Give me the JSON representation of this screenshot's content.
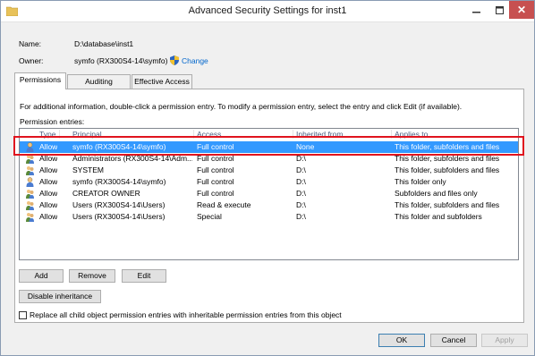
{
  "window": {
    "title": "Advanced Security Settings for inst1",
    "close_glyph": "✕"
  },
  "fields": {
    "name_label": "Name:",
    "name_value": "D:\\database\\inst1",
    "owner_label": "Owner:",
    "owner_value": "symfo (RX300S4-14\\symfo)",
    "change_link": "Change"
  },
  "tabs": [
    {
      "label": "Permissions",
      "active": true
    },
    {
      "label": "Auditing",
      "active": false
    },
    {
      "label": "Effective Access",
      "active": false
    }
  ],
  "permissions": {
    "info_text": "For additional information, double-click a permission entry. To modify a permission entry, select the entry and click Edit (if available).",
    "entries_label": "Permission entries:",
    "columns": [
      "Type",
      "Principal",
      "Access",
      "Inherited from",
      "Applies to"
    ],
    "rows": [
      {
        "type": "Allow",
        "principal": "symfo (RX300S4-14\\symfo)",
        "access": "Full control",
        "inherited": "None",
        "applies": "This folder, subfolders and files",
        "selected": true,
        "icon": "single-user-icon"
      },
      {
        "type": "Allow",
        "principal": "Administrators (RX300S4-14\\Adm...",
        "access": "Full control",
        "inherited": "D:\\",
        "applies": "This folder, subfolders and files",
        "selected": false,
        "icon": "group-icon"
      },
      {
        "type": "Allow",
        "principal": "SYSTEM",
        "access": "Full control",
        "inherited": "D:\\",
        "applies": "This folder, subfolders and files",
        "selected": false,
        "icon": "group-icon"
      },
      {
        "type": "Allow",
        "principal": "symfo (RX300S4-14\\symfo)",
        "access": "Full control",
        "inherited": "D:\\",
        "applies": "This folder only",
        "selected": false,
        "icon": "single-user-icon"
      },
      {
        "type": "Allow",
        "principal": "CREATOR OWNER",
        "access": "Full control",
        "inherited": "D:\\",
        "applies": "Subfolders and files only",
        "selected": false,
        "icon": "group-icon"
      },
      {
        "type": "Allow",
        "principal": "Users (RX300S4-14\\Users)",
        "access": "Read & execute",
        "inherited": "D:\\",
        "applies": "This folder, subfolders and files",
        "selected": false,
        "icon": "group-icon"
      },
      {
        "type": "Allow",
        "principal": "Users (RX300S4-14\\Users)",
        "access": "Special",
        "inherited": "D:\\",
        "applies": "This folder and subfolders",
        "selected": false,
        "icon": "group-icon"
      }
    ]
  },
  "buttons": {
    "add": "Add",
    "remove": "Remove",
    "edit": "Edit",
    "disable_inheritance": "Disable inheritance",
    "ok": "OK",
    "cancel": "Cancel",
    "apply": "Apply"
  },
  "replace_checkbox": {
    "label": "Replace all child object permission entries with inheritable permission entries from this object",
    "checked": false
  },
  "colors": {
    "selection": "#3399ff",
    "highlight_border": "#e0141e",
    "link": "#0066cc"
  }
}
